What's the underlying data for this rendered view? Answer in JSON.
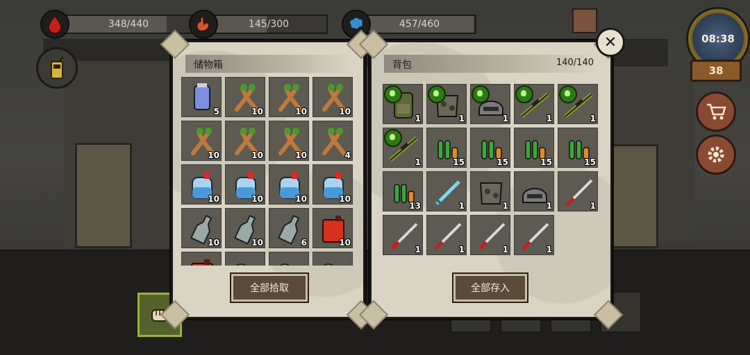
{
  "stats": {
    "health": {
      "value": "348/440",
      "fraction": 0.79
    },
    "hunger": {
      "value": "145/300",
      "fraction": 0.48
    },
    "thirst": {
      "value": "457/460",
      "fraction": 0.99
    }
  },
  "hud": {
    "clock_time": "08:38",
    "day": "38"
  },
  "storage": {
    "title": "储物箱",
    "button": "全部拾取",
    "slots": [
      {
        "item": "purple-potion",
        "qty": "5"
      },
      {
        "item": "ginseng-root",
        "qty": "10"
      },
      {
        "item": "ginseng-root",
        "qty": "10"
      },
      {
        "item": "ginseng-root",
        "qty": "10"
      },
      {
        "item": "ginseng-root",
        "qty": "10"
      },
      {
        "item": "ginseng-root",
        "qty": "10"
      },
      {
        "item": "ginseng-root",
        "qty": "10"
      },
      {
        "item": "ginseng-root",
        "qty": "4"
      },
      {
        "item": "water-jug",
        "qty": "10"
      },
      {
        "item": "water-jug",
        "qty": "10"
      },
      {
        "item": "water-jug",
        "qty": "10"
      },
      {
        "item": "water-jug",
        "qty": "10"
      },
      {
        "item": "empty-bottle",
        "qty": "10"
      },
      {
        "item": "empty-bottle",
        "qty": "10"
      },
      {
        "item": "empty-bottle",
        "qty": "6"
      },
      {
        "item": "red-gas-can",
        "qty": "10"
      },
      {
        "item": "red-gas-can",
        "qty": ""
      },
      {
        "item": "metal-scrap",
        "qty": ""
      },
      {
        "item": "metal-scrap",
        "qty": ""
      },
      {
        "item": "metal-scrap",
        "qty": ""
      }
    ]
  },
  "backpack": {
    "title": "背包",
    "capacity": "140/140",
    "button": "全部存入",
    "slots": [
      {
        "item": "camo-backpack",
        "qty": "1",
        "badge": true
      },
      {
        "item": "camo-armor",
        "qty": "1",
        "badge": true
      },
      {
        "item": "steel-helmet",
        "qty": "1",
        "badge": true
      },
      {
        "item": "sniper-rifle",
        "qty": "1",
        "badge": true
      },
      {
        "item": "sniper-rifle",
        "qty": "1",
        "badge": true
      },
      {
        "item": "sniper-rifle",
        "qty": "1",
        "badge": true
      },
      {
        "item": "rifle-ammo",
        "qty": "15",
        "badge": false
      },
      {
        "item": "rifle-ammo",
        "qty": "15",
        "badge": false
      },
      {
        "item": "rifle-ammo",
        "qty": "15",
        "badge": false
      },
      {
        "item": "rifle-ammo",
        "qty": "15",
        "badge": false
      },
      {
        "item": "rifle-ammo",
        "qty": "13",
        "badge": false
      },
      {
        "item": "ice-sword",
        "qty": "1",
        "badge": false
      },
      {
        "item": "camo-armor",
        "qty": "1",
        "badge": false
      },
      {
        "item": "steel-helmet",
        "qty": "1",
        "badge": false
      },
      {
        "item": "katana",
        "qty": "1",
        "badge": false
      },
      {
        "item": "katana",
        "qty": "1",
        "badge": false
      },
      {
        "item": "katana",
        "qty": "1",
        "badge": false
      },
      {
        "item": "katana",
        "qty": "1",
        "badge": false
      },
      {
        "item": "katana",
        "qty": "1",
        "badge": false
      }
    ]
  },
  "icons": {
    "health": "blood-drop-icon",
    "hunger": "stomach-icon",
    "thirst": "brain-icon",
    "radio": "walkie-talkie-icon",
    "shop": "cart-icon",
    "settings": "gear-icon",
    "close": "close-icon",
    "fist": "fist-icon"
  },
  "colors": {
    "badge_green": "#2d7a14",
    "panel_paper": "#d9d4c3",
    "slot": "#5d5a52"
  }
}
